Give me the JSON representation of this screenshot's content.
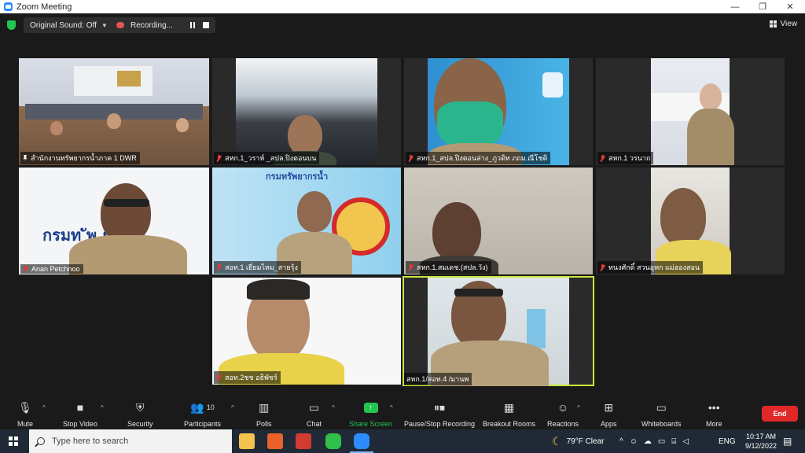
{
  "window": {
    "title": "Zoom Meeting",
    "minimize": "—",
    "restore": "❐",
    "close": "✕"
  },
  "topbar": {
    "sound_label": "Original Sound: Off",
    "recording_label": "Recording...",
    "view_label": "View"
  },
  "participants": [
    {
      "name": "สำนักงานทรัพยากรน้ำภาค 1 DWR",
      "muted": false,
      "pinned": true
    },
    {
      "name": "สหก.1_วราห์ _สปล.ปิงตอนบน",
      "muted": true
    },
    {
      "name": "สหก.1_สปล.ปิงตอนล่าง_ภูวดิท ภถม.ณีโชติ",
      "muted": true
    },
    {
      "name": "สหก.1 วรนาถ",
      "muted": true
    },
    {
      "name": "Anan Petchnoo",
      "muted": true
    },
    {
      "name": "สอท.1 เยี่ยมไหม_สายรุ้ง",
      "muted": true
    },
    {
      "name": "สหก.1.สมเดช.(สปล.วัง)",
      "muted": true
    },
    {
      "name": "ทนงศักดิ์ สวนอุทก แม่ฮองสอน",
      "muted": true
    },
    {
      "name": "สอท.2ชช อธิพัชร์",
      "muted": true
    },
    {
      "name": "สหก.1/สอท.4 /มานพ",
      "muted": false,
      "active": true
    }
  ],
  "toolbar": {
    "mute": "Mute",
    "stop_video": "Stop Video",
    "security": "Security",
    "participants": "Participants",
    "participants_count": "10",
    "polls": "Polls",
    "chat": "Chat",
    "share_screen": "Share Screen",
    "pause_recording": "Pause/Stop Recording",
    "breakout_rooms": "Breakout Rooms",
    "reactions": "Reactions",
    "apps": "Apps",
    "whiteboards": "Whiteboards",
    "more": "More",
    "end": "End"
  },
  "taskbar": {
    "search_placeholder": "Type here to search",
    "weather": "79°F  Clear",
    "language": "ENG",
    "time": "10:17 AM",
    "date": "9/12/2022"
  },
  "colors": {
    "accent_green": "#23c552",
    "end_red": "#e02828",
    "active_speaker": "#c8e63c",
    "taskbar": "#202a36"
  }
}
